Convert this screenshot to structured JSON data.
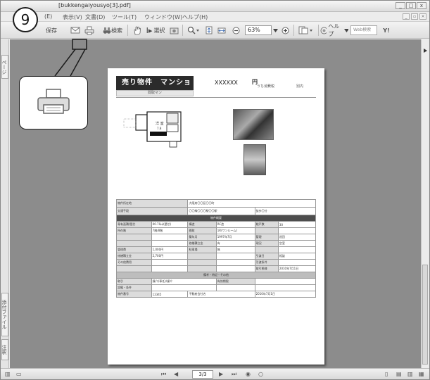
{
  "window": {
    "title": "[bukkengaiyousyo[3].pdf]",
    "controls": [
      "_",
      "□",
      "x"
    ]
  },
  "menubar": {
    "items": [
      "(E)",
      "表示(V)",
      "文書(D)",
      "ツール(T)",
      "ウィンドウ(W)",
      "ヘルプ(H)"
    ]
  },
  "toolbar": {
    "save_label": "保存",
    "search_label": "検索",
    "select_label": "選択",
    "zoom_value": "63%",
    "help_label": "ヘルプ",
    "search_placeholder": "Web検索",
    "yahoo_label": "Y!"
  },
  "leftpane": {
    "tabs": [
      "ページ",
      "添付ファイル",
      "注釈"
    ]
  },
  "document": {
    "title": "売り物件　マンション",
    "subtitle": "間取マン",
    "price": "XXXXXX",
    "yen": "円",
    "price_note": "うち消費税",
    "price_note2": "別内",
    "floorplan_label": "洋 室",
    "floorplan_size": "7.8",
    "table": {
      "location_label": "物件所在地",
      "location_value": "大阪府〇〇区〇〇町",
      "transport_label": "交通手段",
      "transport_value": "〇〇線〇〇〇駅〇〇駅",
      "transport_note": "徒歩〇分",
      "section_header": "物件概要",
      "rows": [
        [
          "専有面積/壁芯",
          "00.70㎡(壁芯)",
          "構造",
          "RC造",
          "総戸数",
          "30"
        ],
        [
          "所在階",
          "7階/8階",
          "間取",
          "1R(ワンルーム)",
          "",
          ""
        ],
        [
          "",
          "",
          "築年月",
          "1997年7月",
          "管理",
          "巡回"
        ],
        [
          "",
          "",
          "修繕積立金",
          "有",
          "現況",
          "空室"
        ],
        [
          "管理費",
          "1,000円",
          "駐車場",
          "無",
          "",
          ""
        ],
        [
          "修繕積立金",
          "2,700円",
          "",
          "",
          "引渡日",
          "相談"
        ],
        [
          "その他費用",
          "",
          "",
          "",
          "引渡条件",
          ""
        ],
        [
          "",
          "",
          "",
          "",
          "取引態様",
          "2010年7月1日"
        ]
      ],
      "section2_header": "備考・特記・その他",
      "rows2": [
        [
          "取引",
          "媒介(専任)/媒介",
          "有効期限",
          ""
        ],
        [
          "設備・条件",
          "",
          "",
          ""
        ],
        [
          "物件番号",
          "12345",
          "不動産会社名",
          "2010年7月1日"
        ]
      ]
    }
  },
  "statusbar": {
    "page_value": "3/3"
  },
  "callout": {
    "number": "9"
  },
  "colors": {
    "header_dark": "#2b2b2b",
    "doc_bg": "#8c8c8c"
  }
}
